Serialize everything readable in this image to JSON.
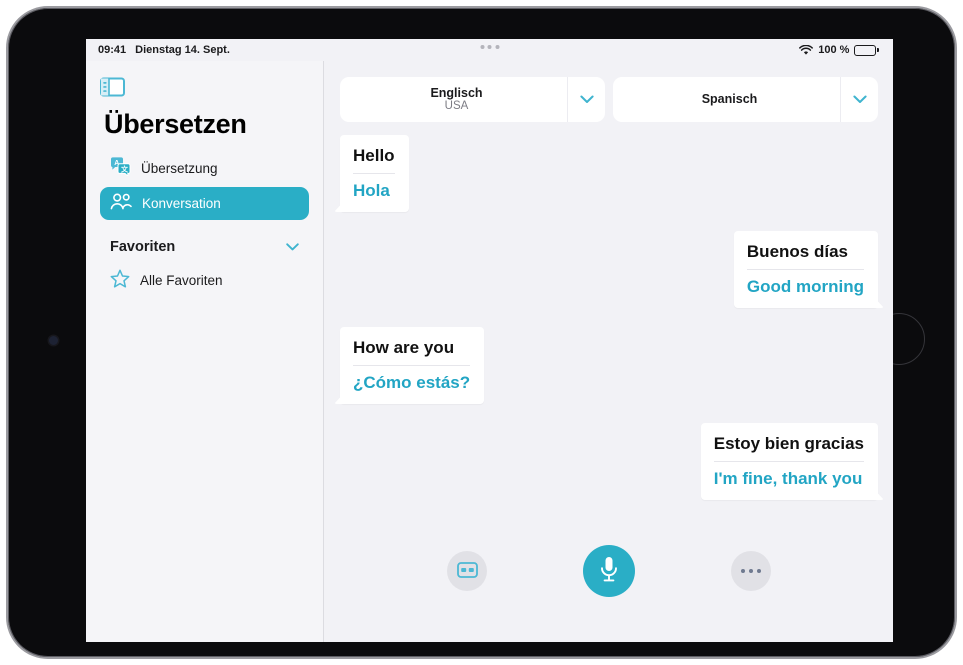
{
  "status_bar": {
    "time": "09:41",
    "date": "Dienstag 14. Sept.",
    "wifi_icon": "wifi-icon",
    "battery_percent": "100 %",
    "battery_icon": "battery-full-icon"
  },
  "sidebar": {
    "toggle_icon": "sidebar-toggle-icon",
    "app_title": "Übersetzen",
    "items": [
      {
        "label": "Übersetzung",
        "icon": "translate-bubbles-icon",
        "active": false
      },
      {
        "label": "Konversation",
        "icon": "two-people-icon",
        "active": true
      }
    ],
    "favorites_section": {
      "title": "Favoriten",
      "chevron_icon": "chevron-down-icon",
      "items": [
        {
          "label": "Alle Favoriten",
          "icon": "star-outline-icon"
        }
      ]
    }
  },
  "main": {
    "multitask_handle_icon": "multitask-handle-icon",
    "language_selectors": [
      {
        "name": "Englisch",
        "region": "USA",
        "chevron_icon": "chevron-down-icon"
      },
      {
        "name": "Spanisch",
        "region": "",
        "chevron_icon": "chevron-down-icon"
      }
    ],
    "messages": [
      {
        "side": "left",
        "source": "Hello",
        "target": "Hola"
      },
      {
        "side": "right",
        "source": "Buenos días",
        "target": "Good morning"
      },
      {
        "side": "left",
        "source": "How are you",
        "target": "¿Cómo estás?"
      },
      {
        "side": "right",
        "source": "Estoy bien gracias",
        "target": "I'm fine, thank you"
      }
    ],
    "toolbar": {
      "side_by_side_icon": "side-by-side-view-icon",
      "microphone_icon": "microphone-icon",
      "more_icon": "more-ellipsis-icon"
    }
  },
  "colors": {
    "accent": "#2aaec6",
    "translation_text": "#22a5c4",
    "screen_background": "#f2f2f6",
    "sidebar_background": "#f5f5f8"
  }
}
